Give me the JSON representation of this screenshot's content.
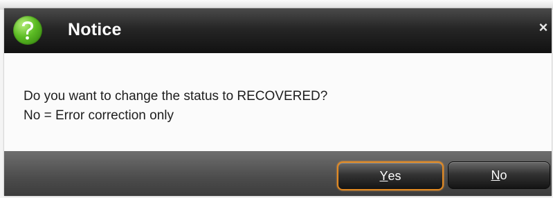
{
  "dialog": {
    "title": "Notice",
    "close_glyph": "×",
    "icon": "question-help-icon",
    "message_line1": "Do you want to change the status to RECOVERED?",
    "message_line2": "No = Error correction only"
  },
  "buttons": {
    "yes": {
      "mnemonic": "Y",
      "rest": "es"
    },
    "no": {
      "mnemonic": "N",
      "rest": "o"
    }
  },
  "colors": {
    "title_bar": "#1c1c1c",
    "footer": "#4c4c4c",
    "icon_green": "#5cbc24",
    "focus_outline": "#e38a22"
  }
}
